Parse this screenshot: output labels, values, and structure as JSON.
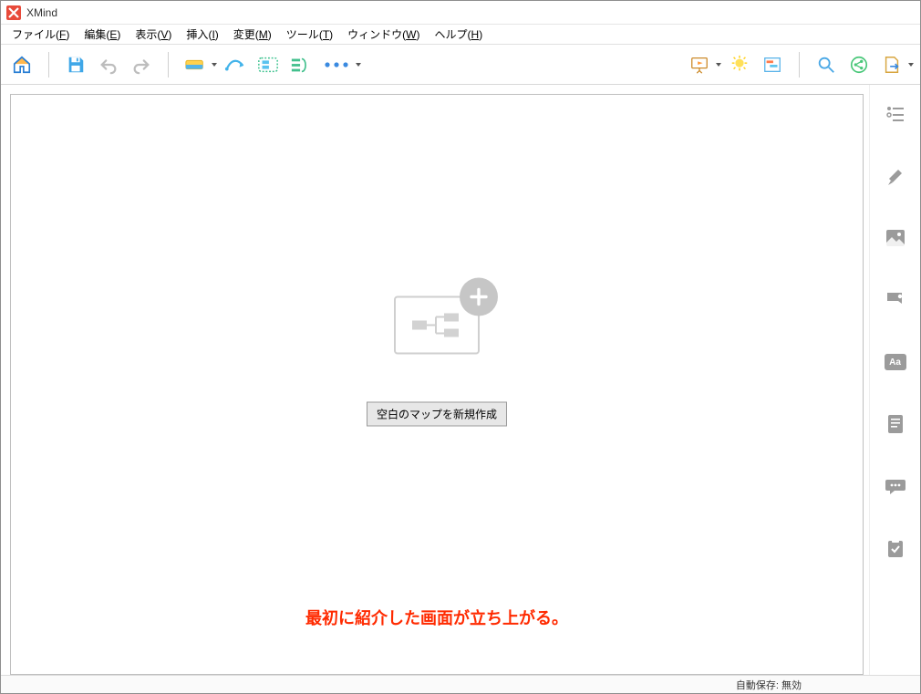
{
  "title": "XMind",
  "menus": {
    "file": {
      "label": "ファイル",
      "key": "F"
    },
    "edit": {
      "label": "編集",
      "key": "E"
    },
    "view": {
      "label": "表示",
      "key": "V"
    },
    "insert": {
      "label": "挿入",
      "key": "I"
    },
    "modify": {
      "label": "変更",
      "key": "M"
    },
    "tools": {
      "label": "ツール",
      "key": "T"
    },
    "window": {
      "label": "ウィンドウ",
      "key": "W"
    },
    "help": {
      "label": "ヘルプ",
      "key": "H"
    }
  },
  "toolbar_icons": {
    "home": "home-icon",
    "save": "save-icon",
    "undo": "undo-icon",
    "redo": "redo-icon",
    "topic": "topic-icon",
    "relationship": "relationship-icon",
    "boundary": "boundary-icon",
    "summary": "summary-icon",
    "more": "more-icon",
    "presentation": "presentation-icon",
    "brainstorm": "brainstorm-icon",
    "gantt": "gantt-icon",
    "search": "search-icon",
    "share": "share-icon",
    "export": "export-icon"
  },
  "right_panel": {
    "outline": "outline-icon",
    "format": "format-icon",
    "image": "image-icon",
    "marker": "marker-icon",
    "text": "text-label-icon",
    "notes": "notes-icon",
    "comments": "comments-icon",
    "task": "task-icon"
  },
  "right_panel_text_badge": "Aa",
  "canvas": {
    "new_map_button": "空白のマップを新規作成",
    "annotation": "最初に紹介した画面が立ち上がる。"
  },
  "status": {
    "autosave": "自動保存: 無効"
  }
}
